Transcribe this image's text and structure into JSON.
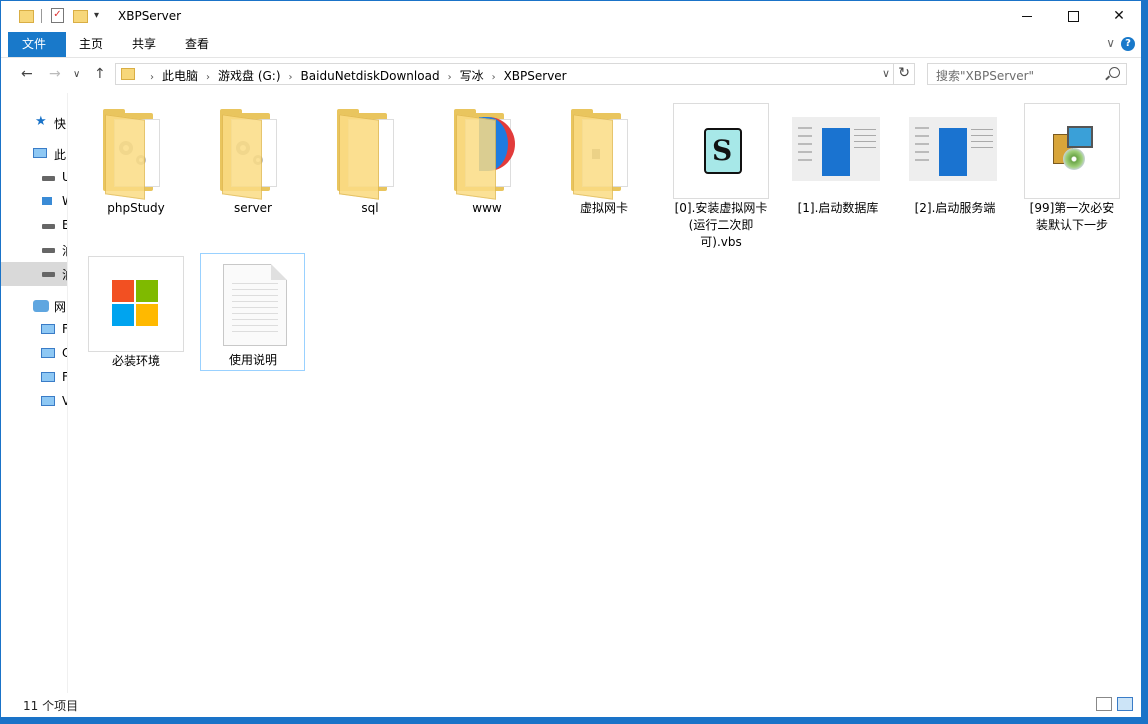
{
  "window": {
    "title": "XBPServer"
  },
  "ribbon": {
    "tabs": [
      "文件",
      "主页",
      "共享",
      "查看"
    ]
  },
  "address": {
    "crumbs": [
      "此电脑",
      "游戏盘 (G:)",
      "BaiduNetdiskDownload",
      "写冰",
      "XBPServer"
    ],
    "search_placeholder": "搜索\"XBPServer\""
  },
  "navpane": {
    "items": [
      {
        "label": "快",
        "icon": "star-icon"
      },
      {
        "label": "此",
        "icon": "computer-icon"
      },
      {
        "label": "U",
        "icon": "drive-icon"
      },
      {
        "label": "W",
        "icon": "network-drive-icon"
      },
      {
        "label": "E",
        "icon": "drive-icon"
      },
      {
        "label": "泊",
        "icon": "drive-icon"
      },
      {
        "label": "泊",
        "icon": "drive-icon"
      },
      {
        "label": "网",
        "icon": "network-icon"
      },
      {
        "label": "F",
        "icon": "computer-icon"
      },
      {
        "label": "C",
        "icon": "computer-icon"
      },
      {
        "label": "F",
        "icon": "computer-icon"
      },
      {
        "label": "V",
        "icon": "computer-icon"
      }
    ]
  },
  "files": [
    {
      "name": "phpStudy",
      "kind": "folder"
    },
    {
      "name": "server",
      "kind": "folder"
    },
    {
      "name": "sql",
      "kind": "folder"
    },
    {
      "name": "www",
      "kind": "folder"
    },
    {
      "name": "虚拟网卡",
      "kind": "folder"
    },
    {
      "name": "[0].安装虚拟网卡(运行二次即可).vbs",
      "kind": "vbs-script"
    },
    {
      "name": "[1].启动数据库",
      "kind": "shortcut"
    },
    {
      "name": "[2].启动服务端",
      "kind": "shortcut"
    },
    {
      "name": "[99]第一次必安装默认下一步",
      "kind": "installer"
    },
    {
      "name": "必装环境",
      "kind": "application"
    },
    {
      "name": "使用说明",
      "kind": "text-document"
    }
  ],
  "status": {
    "item_count": "11 个项目"
  },
  "colors": {
    "accent": "#1979ca",
    "folder": "#fbdc84",
    "selection_border": "#99d1ff"
  }
}
